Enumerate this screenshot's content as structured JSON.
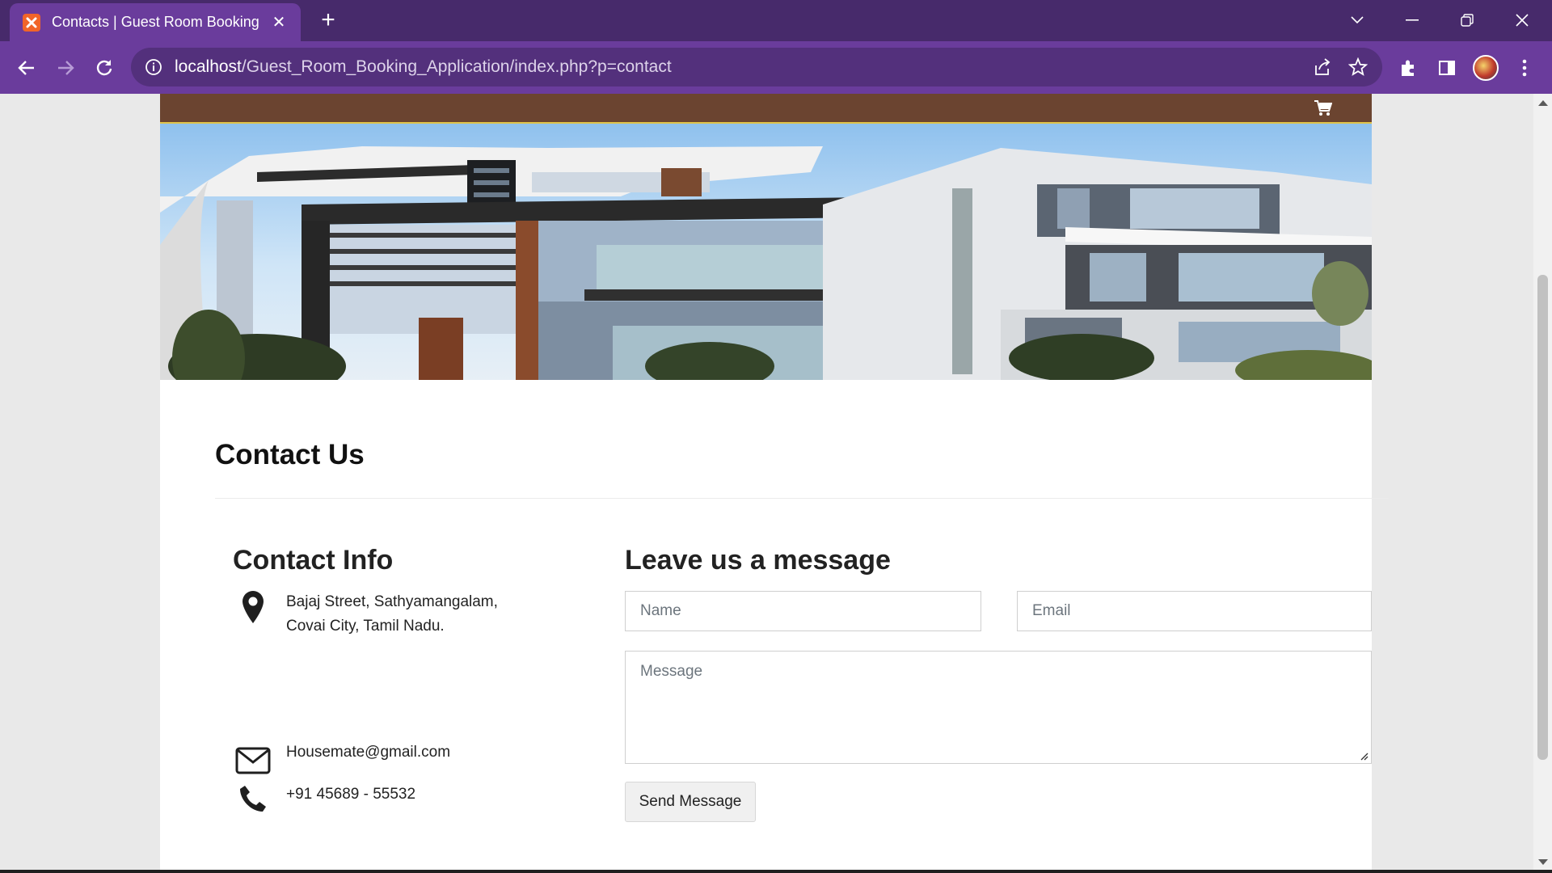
{
  "browser": {
    "tab_title": "Contacts | Guest Room Booking",
    "favicon_text": "ꗀ",
    "new_tab_label": "+",
    "close_label": "✕",
    "url_host": "localhost",
    "url_path": "/Guest_Room_Booking_Application/index.php?p=contact"
  },
  "colors": {
    "tabstrip": "#472a6b",
    "toolbar": "#6a3c9c",
    "topbar": "#6b4430",
    "topbar_border": "#e0c34a"
  },
  "icons": [
    "back-arrow-icon",
    "forward-arrow-icon",
    "reload-icon",
    "info-icon",
    "share-icon",
    "star-icon",
    "extensions-icon",
    "side-panel-icon",
    "avatar",
    "more-vert-icon",
    "cart-icon",
    "map-pin-icon",
    "envelope-icon",
    "phone-icon"
  ],
  "page": {
    "title": "Contact Us",
    "contact_info": {
      "heading": "Contact Info",
      "address_line1": "Bajaj Street, Sathyamangalam,",
      "address_line2": "Covai City, Tamil Nadu.",
      "email": "Housemate@gmail.com",
      "phone": "+91 45689 - 55532"
    },
    "form": {
      "heading": "Leave us a message",
      "name_placeholder": "Name",
      "email_placeholder": "Email",
      "message_placeholder": "Message",
      "submit_label": "Send Message"
    }
  }
}
